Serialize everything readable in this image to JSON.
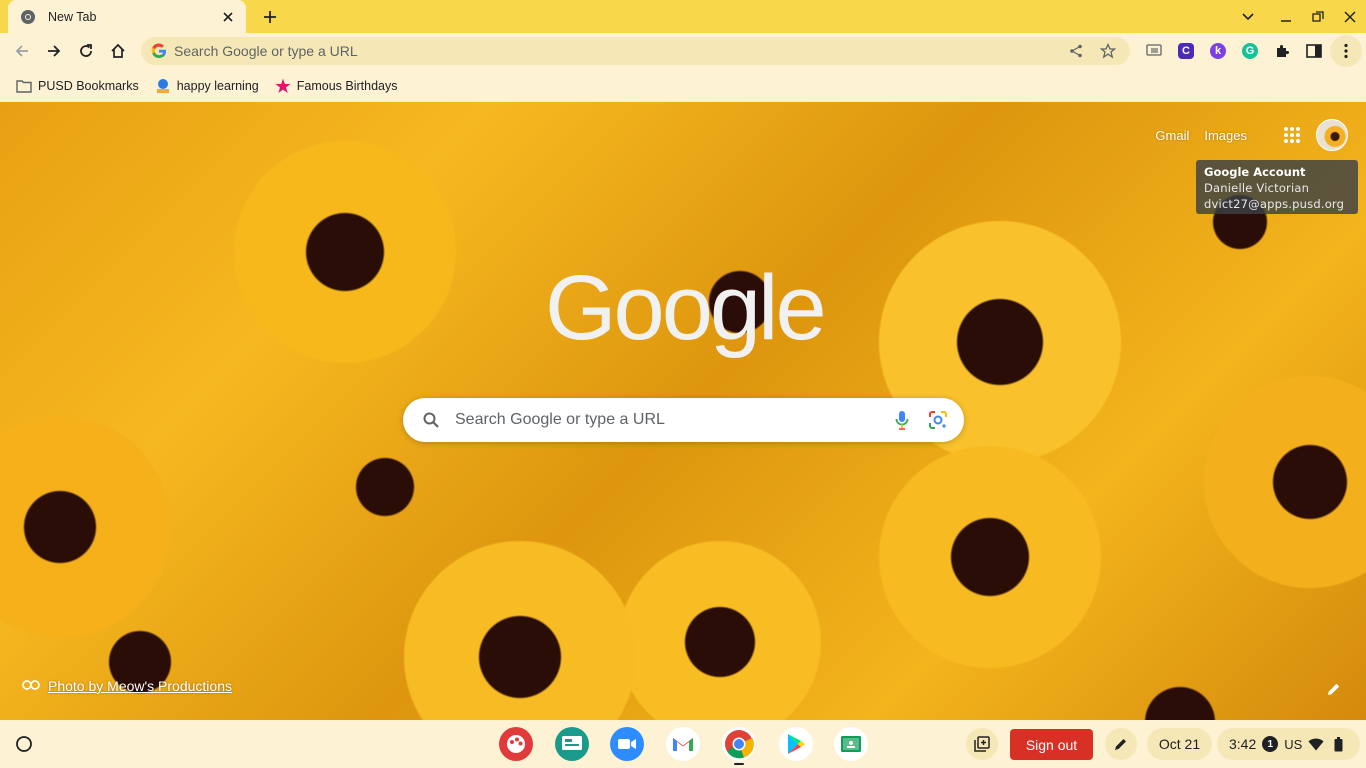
{
  "tab": {
    "title": "New Tab"
  },
  "omnibox": {
    "placeholder": "Search Google or type a URL"
  },
  "bookmarks": [
    {
      "label": "PUSD Bookmarks",
      "icon": "folder-icon"
    },
    {
      "label": "happy learning",
      "icon": "happy-learning-favicon"
    },
    {
      "label": "Famous Birthdays",
      "icon": "famous-birthdays-favicon"
    }
  ],
  "extensions": [
    {
      "letter": "C",
      "color": "#4c2ab8"
    },
    {
      "letter": "k",
      "color": "#7b3fe4"
    },
    {
      "letter": "G",
      "color": "#15c39a"
    }
  ],
  "ntp": {
    "gmail": "Gmail",
    "images": "Images",
    "logo": "Google",
    "search_placeholder": "Search Google or type a URL",
    "attribution": "Photo by Meow's Productions"
  },
  "account_tooltip": {
    "title": "Google Account",
    "name": "Danielle Victorian",
    "email": "dvict27@apps.pusd.org"
  },
  "shelf": {
    "apps": [
      "canvas-icon",
      "google-classroom-icon",
      "zoom-icon",
      "gmail-icon",
      "chrome-icon",
      "play-store-icon",
      "google-classroom-green-icon"
    ],
    "signout": "Sign out",
    "date": "Oct 21",
    "time": "3:42",
    "notification_count": "1",
    "ime": "US"
  },
  "colors": {
    "tabstrip": "#f8d84a",
    "toolbar": "#fdf3d4",
    "signout": "#d93025"
  }
}
